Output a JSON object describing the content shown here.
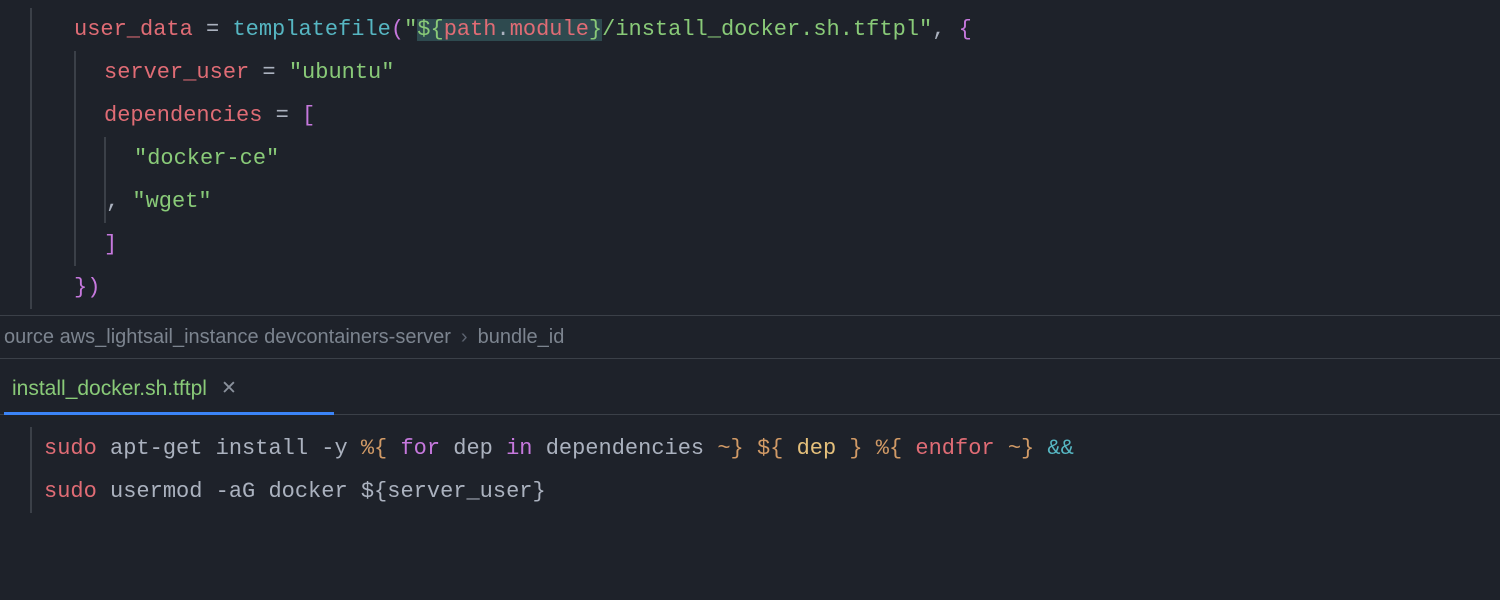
{
  "top_editor": {
    "l1_prop": "user_data",
    "l1_eq": " = ",
    "l1_func": "templatefile",
    "l1_open": "(",
    "l1_q1": "\"",
    "l1_interp_open": "${",
    "l1_path_a": "path",
    "l1_dot": ".",
    "l1_path_b": "module",
    "l1_interp_close": "}",
    "l1_rest": "/install_docker.sh.tftpl",
    "l1_q2": "\"",
    "l1_comma": ",",
    "l1_brace": " {",
    "l2_prop": "server_user",
    "l2_eq": " = ",
    "l2_val": "\"ubuntu\"",
    "l3_prop": "dependencies",
    "l3_eq": " = ",
    "l3_bracket": "[",
    "l4_val": "\"docker-ce\"",
    "l5_comma": ", ",
    "l5_val": "\"wget\"",
    "l6_bracket": "]",
    "l7_close": "})"
  },
  "breadcrumb": {
    "seg1": "ource aws_lightsail_instance devcontainers-server",
    "seg2": "bundle_id"
  },
  "tab": {
    "label": "install_docker.sh.tftpl"
  },
  "bottom_editor": {
    "l1_sudo": "sudo",
    "l1_mid": " apt-get install -y ",
    "l1_td1": "%{",
    "l1_sp1": " ",
    "l1_for": "for",
    "l1_sp2": " dep ",
    "l1_in": "in",
    "l1_sp3": " dependencies ",
    "l1_td2": "~}",
    "l1_sp4": " ",
    "l1_io": "${",
    "l1_sp5": " ",
    "l1_dep": "dep",
    "l1_sp6": " ",
    "l1_ic": "}",
    "l1_sp7": " ",
    "l1_td3": "%{",
    "l1_sp8": " ",
    "l1_endfor": "endfor",
    "l1_sp9": " ",
    "l1_td4": "~}",
    "l1_sp10": " ",
    "l1_amp": "&&",
    "l2_sudo": "sudo",
    "l2_rest": " usermod -aG docker ",
    "l2_io": "${",
    "l2_var": "server_user",
    "l2_ic": "}"
  }
}
